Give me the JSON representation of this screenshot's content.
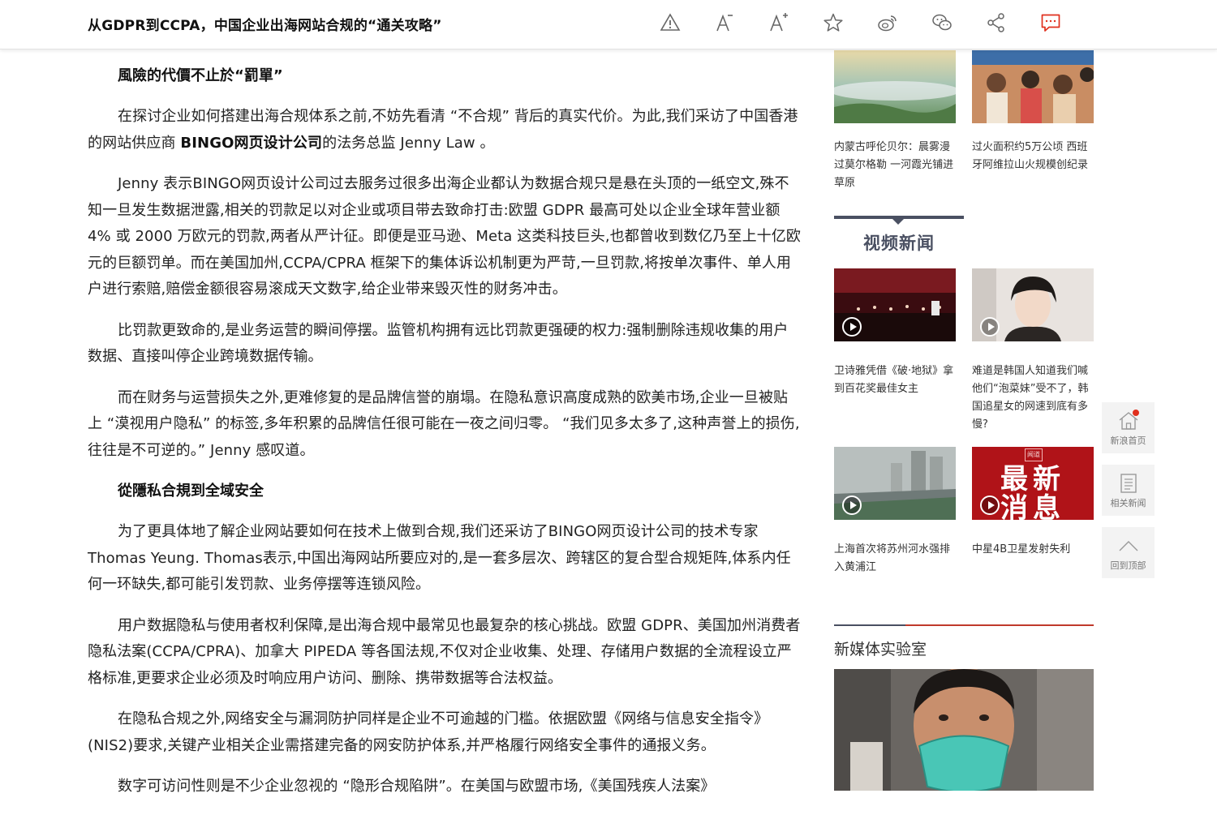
{
  "header": {
    "title": "从GDPR到CCPA，中国企业出海网站合规的“通关攻略”",
    "icons": [
      "warning-icon",
      "font-decrease-icon",
      "font-increase-icon",
      "star-icon",
      "weibo-icon",
      "wechat-icon",
      "share-icon",
      "comment-icon"
    ],
    "accent_color": "#e0301e"
  },
  "article": {
    "h1": "風險的代價不止於“罰單”",
    "p1_a": "在探讨企业如何搭建出海合规体系之前,不妨先看清 “不合规” 背后的真实代价。为此,我们采访了中国香港的网站供应商 ",
    "p1_bold": "BINGO网页设计公司",
    "p1_b": "的法务总监 Jenny Law 。",
    "p2": "Jenny 表示BINGO网页设计公司过去服务过很多出海企业都认为数据合规只是悬在头顶的一纸空文,殊不知一旦发生数据泄露,相关的罚款足以对企业或项目带去致命打击:欧盟 GDPR 最高可处以企业全球年营业额 4% 或 2000 万欧元的罚款,两者从严计征。即便是亚马逊、Meta 这类科技巨头,也都曾收到数亿乃至上十亿欧元的巨额罚单。而在美国加州,CCPA/CPRA 框架下的集体诉讼机制更为严苛,一旦罚款,将按单次事件、单人用户进行索赔,赔偿金额很容易滚成天文数字,给企业带来毁灭性的财务冲击。",
    "p3": "比罚款更致命的,是业务运营的瞬间停摆。监管机构拥有远比罚款更强硬的权力:强制删除违规收集的用户数据、直接叫停企业跨境数据传输。",
    "p4": "而在财务与运营损失之外,更难修复的是品牌信誉的崩塌。在隐私意识高度成熟的欧美市场,企业一旦被贴上 “漠视用户隐私” 的标签,多年积累的品牌信任很可能在一夜之间归零。 “我们见多太多了,这种声誉上的损伤,往往是不可逆的。” Jenny 感叹道。",
    "h2": "從隱私合規到全域安全",
    "p5": "为了更具体地了解企业网站要如何在技术上做到合规,我们还采访了BINGO网页设计公司的技术专家 Thomas Yeung. Thomas表示,中国出海网站所要应对的,是一套多层次、跨辖区的复合型合规矩阵,体系内任何一环缺失,都可能引发罚款、业务停摆等连锁风险。",
    "p6": "用户数据隐私与使用者权利保障,是出海合规中最常见也最复杂的核心挑战。欧盟 GDPR、美国加州消费者隐私法案(CCPA/CPRA)、加拿大 PIPEDA 等各国法规,不仅对企业收集、处理、存储用户数据的全流程设立严格标准,更要求企业必须及时响应用户访问、删除、携带数据等合法权益。",
    "p7": "在隐私合规之外,网络安全与漏洞防护同样是企业不可逾越的门槛。依据欧盟《网络与信息安全指令》(NIS2)要求,关键产业相关企业需搭建完备的网安防护体系,并严格履行网络安全事件的通报义务。",
    "p8": "数字可访问性则是不少企业忽视的 “隐形合规陷阱”。在美国与欧盟市场,《美国残疾人法案》"
  },
  "sidebar": {
    "news": [
      {
        "caption": "内蒙古呼伦贝尔：晨雾漫过莫尔格勒 一河霞光铺进草原"
      },
      {
        "caption": "过火面积约5万公顷 西班牙阿维拉山火规模创纪录"
      }
    ],
    "video_section_title": "视频新闻",
    "videos": [
      {
        "caption": "卫诗雅凭借《破·地狱》拿到百花奖最佳女主"
      },
      {
        "caption": "难道是韩国人知道我们喊他们“泡菜妹”受不了，韩国追星女的网速到底有多慢?"
      },
      {
        "caption": "上海首次将苏州河水强排入黄浦江"
      },
      {
        "caption": "中星4B卫星发射失利",
        "thumb_text": "最新消息",
        "thumb_badge": "闻道"
      }
    ],
    "lab_title": "新媒体实验室"
  },
  "float_nav": {
    "home": "新浪首页",
    "related": "相关新闻",
    "top": "回到顶部"
  }
}
